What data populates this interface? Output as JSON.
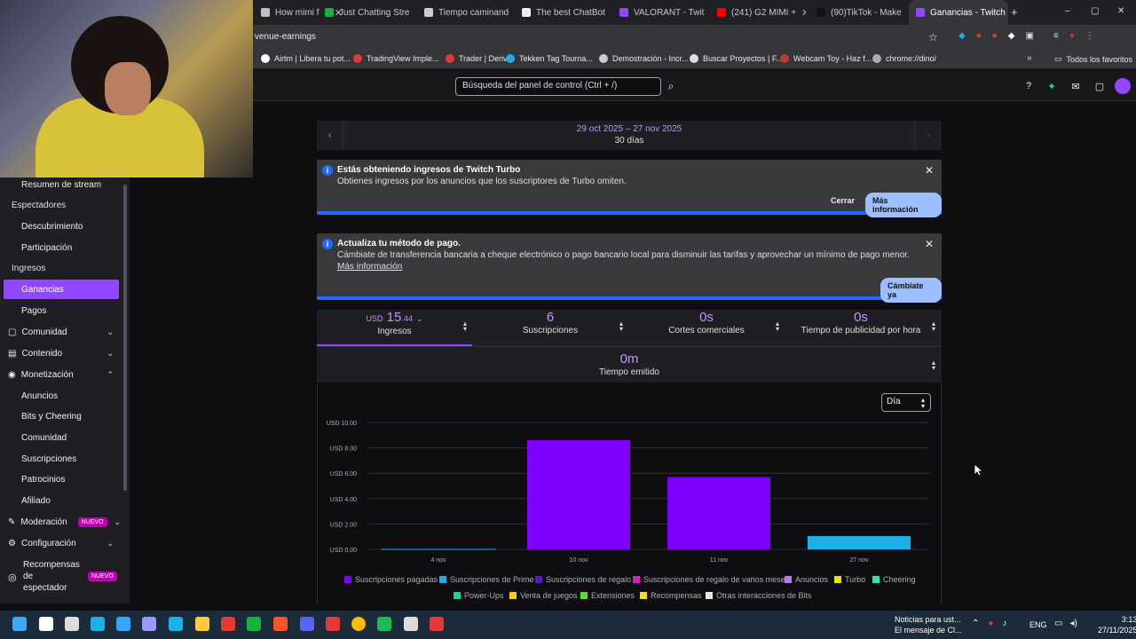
{
  "browser": {
    "tabs": [
      {
        "label": "How mimi f",
        "color": "#c0c0c0"
      },
      {
        "label": "Just Chatting Stre",
        "color": "#16b33c"
      },
      {
        "label": "Tiempo caminand",
        "color": "#ccc"
      },
      {
        "label": "The best ChatBot",
        "color": "#eee"
      },
      {
        "label": "VALORANT - Twit",
        "color": "#9147ff"
      },
      {
        "label": "(241) G2 MIMI + ",
        "color": "#ff0000"
      },
      {
        "label": "(90)TikTok - Make",
        "color": "#111"
      },
      {
        "label": "Ganancias - Twitch",
        "color": "#9147ff"
      }
    ],
    "url": "venue-earnings",
    "bookmarks": [
      "Airtm | Libera tu pot...",
      "TradingView Imple...",
      "Trader | Deriv",
      "Tekken Tag Tourna...",
      "Demostración - Incr...",
      "Buscar Proyectos | F...",
      "Webcam Toy - Haz f...",
      "chrome://dino/"
    ],
    "all_bookmarks": "Todos los favoritos"
  },
  "topnav": {
    "search_placeholder": "Búsqueda del panel de control (Ctrl + /)"
  },
  "sidebar": {
    "items": [
      {
        "label": "Resumen de stream",
        "kind": "item"
      },
      {
        "label": "Espectadores",
        "kind": "cat"
      },
      {
        "label": "Descubrimiento",
        "kind": "item"
      },
      {
        "label": "Participación",
        "kind": "item"
      },
      {
        "label": "Ingresos",
        "kind": "cat"
      },
      {
        "label": "Ganancias",
        "kind": "active"
      },
      {
        "label": "Pagos",
        "kind": "item"
      },
      {
        "label": "Comunidad",
        "kind": "sec"
      },
      {
        "label": "Contenido",
        "kind": "sec"
      },
      {
        "label": "Monetización",
        "kind": "sec"
      },
      {
        "label": "Anuncios",
        "kind": "item"
      },
      {
        "label": "Bits y Cheering",
        "kind": "item"
      },
      {
        "label": "Comunidad",
        "kind": "item"
      },
      {
        "label": "Suscripciones",
        "kind": "item"
      },
      {
        "label": "Patrocinios",
        "kind": "item"
      },
      {
        "label": "Afiliado",
        "kind": "item"
      },
      {
        "label": "Moderación",
        "kind": "sec"
      },
      {
        "label": "Configuración",
        "kind": "sec"
      }
    ],
    "rewards_line1": "Recompensas",
    "rewards_line2": "de",
    "rewards_line3": "espectador",
    "new_badge": "NUEVO"
  },
  "daterange": {
    "range": "29 oct 2025 – 27 nov 2025",
    "days": "30 días"
  },
  "alert1": {
    "title": "Estás obteniendo ingresos de Twitch Turbo",
    "desc": "Obtienes ingresos por los anuncios que los suscriptores de Turbo omiten.",
    "close": "Cerrar",
    "more": "Más información"
  },
  "alert2": {
    "title": "Actualiza tu método de pago.",
    "desc": "Cámbiate de transferencia bancaria a cheque electrónico o pago bancario local para disminuir las tarifas y aprovechar un mínimo de pago menor.",
    "link": "Más información",
    "cta": "Cámbiate ya"
  },
  "stats": {
    "income": {
      "cur": "USD",
      "whole": "15",
      "dec": ".44",
      "label": "Ingresos"
    },
    "subs": {
      "value": "6",
      "label": "Suscripciones"
    },
    "breaks": {
      "value": "0s",
      "label": "Cortes comerciales"
    },
    "adtime": {
      "value": "0s",
      "label": "Tiempo de publicidad por hora"
    },
    "broadcast": {
      "value": "0m",
      "label": "Tiempo emitido"
    }
  },
  "granularity": "Día",
  "chart_data": {
    "type": "bar",
    "categories": [
      "4 nov",
      "10 nov",
      "11 nov",
      "27 nov"
    ],
    "yticks": [
      "USD 0.00",
      "USD 2.00",
      "USD 4.00",
      "USD 6.00",
      "USD 8.00",
      "USD 10.00"
    ],
    "ylim": [
      0,
      10
    ],
    "series": [
      {
        "name": "Suscripciones pagadas",
        "color": "#7f00ff",
        "values": [
          0,
          8.6,
          5.7,
          0
        ]
      },
      {
        "name": "Suscripciones de Prime",
        "color": "#1ab0e8",
        "values": [
          0,
          0,
          0,
          1.05
        ]
      }
    ],
    "legend": [
      {
        "name": "Suscripciones pagadas",
        "color": "#7f00ff"
      },
      {
        "name": "Suscripciones de Prime",
        "color": "#1ab0e8"
      },
      {
        "name": "Suscripciones de regalo",
        "color": "#5c16c5"
      },
      {
        "name": "Suscripciones de regalo de varios meses",
        "color": "#d11fc8"
      },
      {
        "name": "Anuncios",
        "color": "#b47ef0"
      },
      {
        "name": "Turbo",
        "color": "#e5e500"
      },
      {
        "name": "Cheering",
        "color": "#2ee8a8"
      },
      {
        "name": "Power-Ups",
        "color": "#18d6a0"
      },
      {
        "name": "Venta de juegos",
        "color": "#ffcc00"
      },
      {
        "name": "Extensiones",
        "color": "#59e02a"
      },
      {
        "name": "Recompensas",
        "color": "#ffdd00"
      },
      {
        "name": "Otras interacciones de Bits",
        "color": "#e8e8e8"
      }
    ]
  },
  "taskbar": {
    "notif_title": "Noticias para ust...",
    "notif_sub": "El mensaje de Cl...",
    "lang": "ENG",
    "time": "3:13",
    "date": "27/11/2025"
  }
}
